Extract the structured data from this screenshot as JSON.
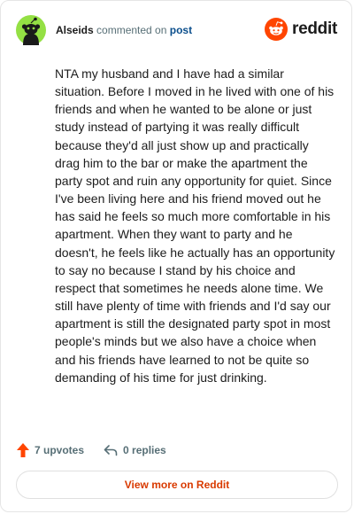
{
  "header": {
    "username": "Alseids",
    "verb": "commented on",
    "link_text": "post",
    "brand": "reddit",
    "avatar_icon": "reddit-snoo-avatar-icon",
    "brand_icon": "reddit-logo-icon",
    "colors": {
      "avatar_bg": "#94e044",
      "brand_orange": "#ff4500",
      "link": "#0a4e8c"
    }
  },
  "comment": {
    "body": "NTA my husband and I have had a similar situation. Before I moved in he lived with one of his friends and when he wanted to be alone or just study instead of partying it was really difficult because they'd all just show up and practically drag him to the bar or make the apartment the party spot and ruin any opportunity for quiet. Since I've been living here and his friend moved out he has said he feels so much more comfortable in his apartment. When they want to party and he doesn't, he feels like he actually has an opportunity to say no because I stand by his choice and respect that sometimes he needs alone time. We still have plenty of time with friends and I'd say our apartment is still the designated party spot in most people's minds but we also have a choice when and his friends have learned to not be quite so demanding of his time for just drinking."
  },
  "actions": {
    "upvotes_label": "7 upvotes",
    "replies_label": "0 replies",
    "upvote_icon": "upvote-arrow-icon",
    "reply_icon": "reply-arrow-icon",
    "upvote_color": "#ff4500"
  },
  "footer": {
    "view_more_label": "View more on Reddit",
    "button_color": "#d93a00"
  }
}
